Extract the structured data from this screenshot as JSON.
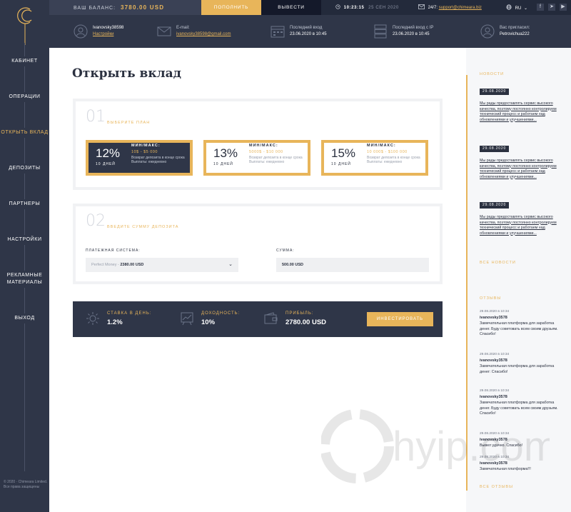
{
  "sidebar": {
    "items": [
      {
        "label": "КАБИНЕТ"
      },
      {
        "label": "ОПЕРАЦИИ"
      },
      {
        "label": "ОТКРЫТЬ ВКЛАД"
      },
      {
        "label": "ДЕПОЗИТЫ"
      },
      {
        "label": "ПАРТНЕРЫ"
      },
      {
        "label": "НАСТРОЙКИ"
      },
      {
        "label": "РЕКЛАМНЫЕ МАТЕРИАЛЫ"
      },
      {
        "label": "ВЫХОД"
      }
    ],
    "copyright": "© 2020 · Chimeara Limited. Все права защищены"
  },
  "topbar": {
    "balance_label": "ВАШ БАЛАНС:",
    "balance_amount": "3780.00 USD",
    "deposit_button": "ПОПОЛНИТЬ",
    "withdraw_button": "ВЫВЕСТИ",
    "time": "10:23:15",
    "date": "25 СЕН 2020",
    "support_label": "24/7:",
    "support_email": "support@chimeara.biz",
    "lang": "RU"
  },
  "infobar": {
    "username": "Ivanovsky38598",
    "settings_link": "Настройки",
    "email_label": "E-mail:",
    "email": "ivanovsky38598@gmail.com",
    "last_login_label": "Последний вход",
    "last_login": "23.06.2020 в 10:45",
    "last_ip_label": "Последний вход с IP",
    "last_ip": "23.06.2020 в 10:45",
    "referrer_label": "Вас пригласил:",
    "referrer": "Petrovichua222"
  },
  "main": {
    "title": "Открыть вклад",
    "step1": {
      "num": "01",
      "label": "ВЫБЕРИТЕ ПЛАН"
    },
    "plans": [
      {
        "pct": "12%",
        "days": "10 ДНЕЙ",
        "mm_label": "МИН/МАКС:",
        "range": "10$ - $5 000",
        "desc": "Возврат депозита в конце срока Выплаты: ежедневно"
      },
      {
        "pct": "13%",
        "days": "10 ДНЕЙ",
        "mm_label": "МИН/МАКС:",
        "range": "5000$ - $10 000",
        "desc": "Возврат депозита в конце срока Выплаты: ежедневно"
      },
      {
        "pct": "15%",
        "days": "10 ДНЕЙ",
        "mm_label": "МИН/МАКС:",
        "range": "10 000$ - $100 000",
        "desc": "Возврат депозита в конце срока Выплаты: ежедневно"
      }
    ],
    "step2": {
      "num": "02",
      "label": "ВВЕДИТЕ СУММУ ДЕПОЗИТА"
    },
    "payment_label": "ПЛАТЕЖНАЯ СИСТЕМА:",
    "payment_system": "Perfect Money -",
    "payment_amount": "2380.00 USD",
    "sum_label": "СУММА:",
    "sum_value": "500.00 USD",
    "summary": {
      "rate_label": "СТАВКА В ДЕНЬ:",
      "rate": "1.2%",
      "yield_label": "ДОХОДНОСТЬ:",
      "yield": "10%",
      "profit_label": "ПРИБЫЛЬ:",
      "profit": "2780.00 USD",
      "invest_button": "ИНВЕСТИРОВАТЬ"
    }
  },
  "news": {
    "heading": "НОВОСТИ",
    "items": [
      {
        "date": "29.08.2020",
        "text": "Мы рады предоставлять сервис высокого качества, поэтому постоянно контролируем технический процесс и работаем над обновлениями и улучшениями..."
      },
      {
        "date": "29.08.2020",
        "text": "Мы рады предоставлять сервис высокого качества, поэтому постоянно контролируем технический процесс и работаем над обновлениями и улучшениями..."
      },
      {
        "date": "29.08.2020",
        "text": "Мы рады предоставлять сервис высокого качества, поэтому постоянно контролируем технический процесс и работаем над обновлениями и улучшениями..."
      }
    ],
    "all_link": "ВСЕ НОВОСТИ"
  },
  "reviews": {
    "heading": "ОТЗЫВЫ",
    "items": [
      {
        "date": "29.08.2020 в 10:34",
        "name": "ivanovsky3578",
        "text": "Замечательная платформа для заработка денег. Буду советовать всем своим друзьям. Спасибо!"
      },
      {
        "date": "29.08.2020 в 10:34",
        "name": "ivanovsky3578",
        "text": "Замечательная платформа для заработка денег: Спасибо!"
      },
      {
        "date": "29.08.2020 в 10:34",
        "name": "ivanovsky3578",
        "text": "Замечательная платформа для заработка денег. Буду советовать всем своим друзьям. Спасибо!"
      },
      {
        "date": "29.08.2020 в 10:34",
        "name": "ivanovsky3578",
        "text": "Вывел удачно. Спасибо!"
      },
      {
        "date": "29.08.2020 в 10:34",
        "name": "ivanovsky3578",
        "text": "Замечательная платформа!!!"
      }
    ],
    "all_link": "ВСЕ ОТЗЫВЫ"
  },
  "watermark": "hyip.com",
  "colors": {
    "accent": "#e8b55a",
    "dark": "#2f3648",
    "darker": "#232a3b",
    "black": "#14192a"
  }
}
